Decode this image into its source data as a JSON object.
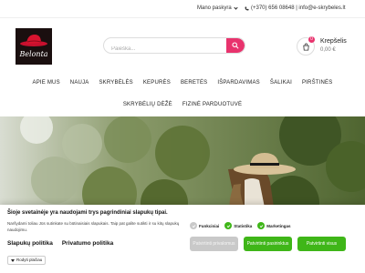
{
  "topbar": {
    "account_label": "Mano paskyra",
    "contact_text": "(+370) 656 08648 | info@e-skrybeles.lt"
  },
  "logo": {
    "brand": "Belonta"
  },
  "search": {
    "placeholder": "Paieška..."
  },
  "cart": {
    "label": "Krepšelis",
    "amount": "0,00 €",
    "count": "0"
  },
  "nav": {
    "row1": [
      "APIE MUS",
      "NAUJA",
      "SKRYBĖLĖS",
      "KEPURĖS",
      "BERETĖS",
      "IŠPARDAVIMAS",
      "ŠALIKAI",
      "PIRŠTINĖS"
    ],
    "row2": [
      "SKRYBĖLIŲ DĖŽĖ",
      "FIZINĖ PARDUOTUVĖ"
    ]
  },
  "cookie": {
    "title": "Šioje svetainėje yra naudojami trys pagrindiniai slapukų tipai.",
    "desc": "Naršydami toliau Jūs sutinkate su būtinaisiais slapukais. Taip pat galite sutikti ir su kitų slapukų naudojimu.",
    "policy_link": "Slapukų politika",
    "privacy_link": "Privatumo politika",
    "more_label": "Rodyti plačiau",
    "checks": [
      "Funkciniai",
      "Statistika",
      "Marketingas"
    ],
    "buttons": {
      "decline": "Patvirtinti privalomus",
      "selected": "Patvirtinti pasirinktus",
      "accept_all": "Patvirtinti visus"
    }
  },
  "colors": {
    "accent": "#e8336d",
    "green": "#3fb618"
  }
}
